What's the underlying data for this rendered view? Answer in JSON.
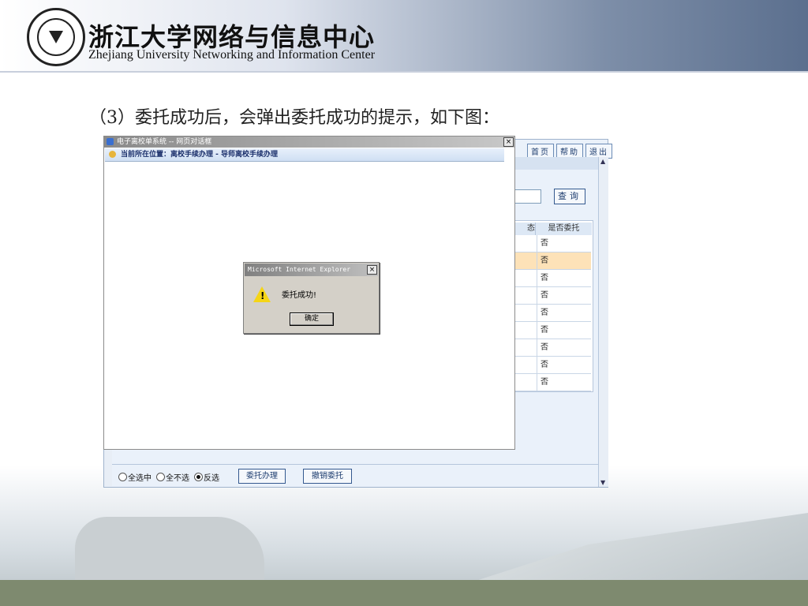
{
  "slide": {
    "org_name_cn": "浙江大学网络与信息中心",
    "org_name_en": "Zhejiang University Networking and Information Center",
    "caption": "（3）委托成功后，会弹出委托成功的提示，如下图："
  },
  "web_dialog": {
    "title": "电子离校单系统 -- 网页对话框",
    "close_label": "×",
    "location": "当前所在位置：离校手续办理 - 导师离校手续办理"
  },
  "app": {
    "top_buttons": [
      "首页",
      "帮助",
      "退出"
    ],
    "query_label": "查询",
    "table": {
      "header_partial": "态",
      "header_delegated": "是否委托",
      "rows": [
        "否",
        "否",
        "否",
        "否",
        "否",
        "否",
        "否",
        "否",
        "否"
      ],
      "selected_row_index": 1
    },
    "options": [
      {
        "label": "全选中",
        "checked": false
      },
      {
        "label": "全不选",
        "checked": false
      },
      {
        "label": "反选",
        "checked": true
      }
    ],
    "buttons": {
      "delegate": "委托办理",
      "cancel_delegate": "撤销委托"
    }
  },
  "message_box": {
    "title": "Microsoft Internet Explorer",
    "message": "委托成功!",
    "ok_label": "确定",
    "close_label": "×"
  }
}
